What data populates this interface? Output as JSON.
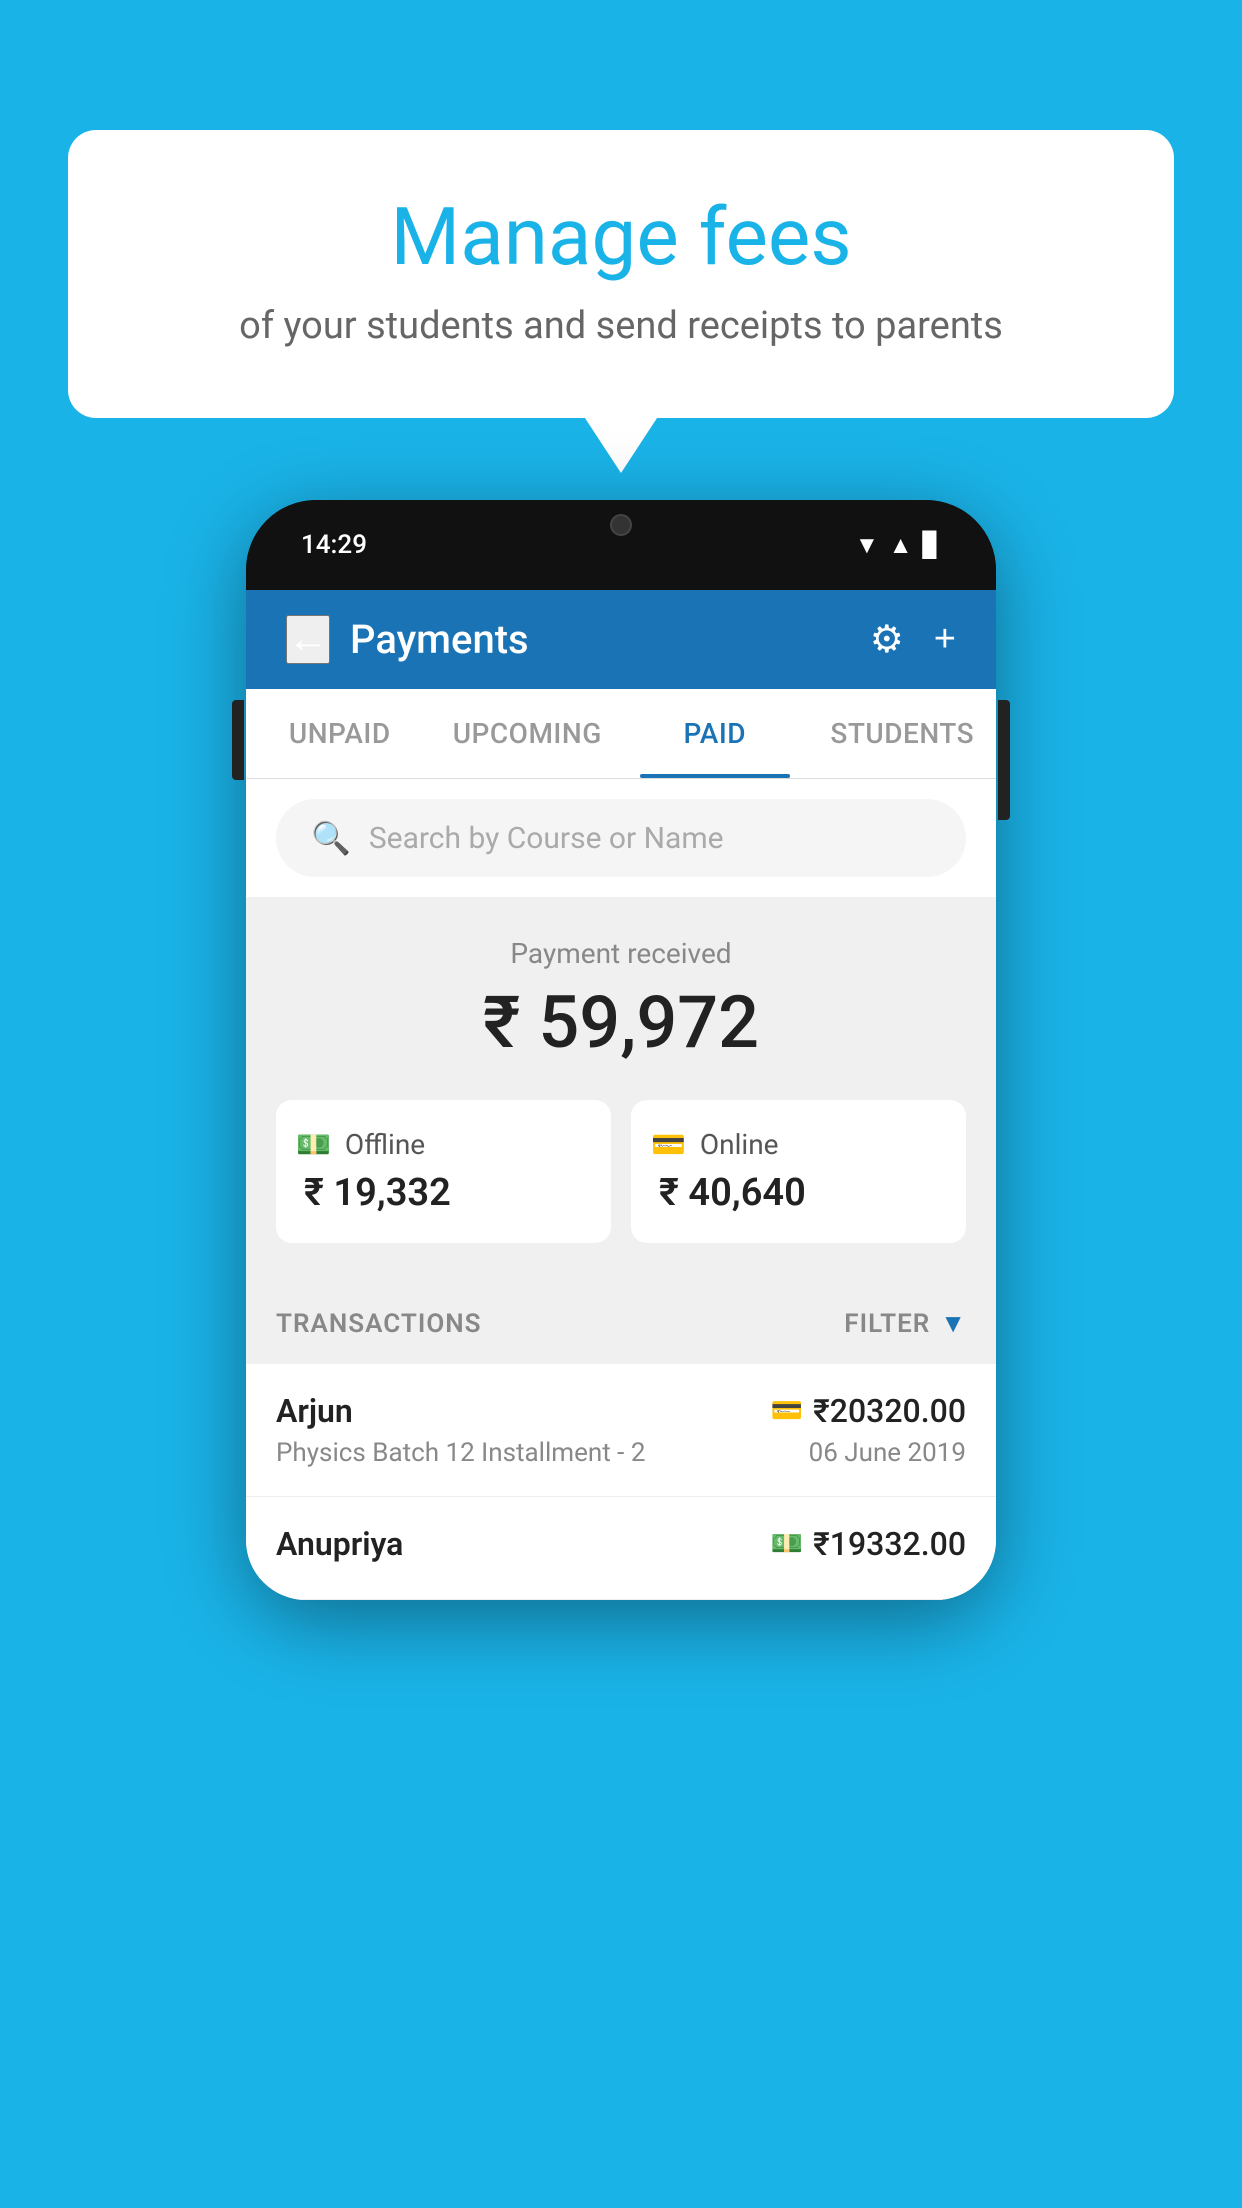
{
  "background": {
    "color": "#1ab3e8"
  },
  "speech_bubble": {
    "heading": "Manage fees",
    "subtitle": "of your students and send receipts to parents"
  },
  "phone": {
    "status_bar": {
      "time": "14:29",
      "wifi": "▲",
      "signal": "▲",
      "battery": "▊"
    },
    "header": {
      "back_label": "←",
      "title": "Payments",
      "gear_icon": "⚙",
      "plus_icon": "+"
    },
    "tabs": [
      {
        "label": "UNPAID",
        "active": false
      },
      {
        "label": "UPCOMING",
        "active": false
      },
      {
        "label": "PAID",
        "active": true
      },
      {
        "label": "STUDENTS",
        "active": false
      }
    ],
    "search": {
      "placeholder": "Search by Course or Name",
      "icon": "🔍"
    },
    "payment_summary": {
      "label": "Payment received",
      "amount": "₹ 59,972",
      "cards": [
        {
          "icon": "💳",
          "type": "Offline",
          "amount": "₹ 19,332"
        },
        {
          "icon": "💳",
          "type": "Online",
          "amount": "₹ 40,640"
        }
      ]
    },
    "transactions_section": {
      "label": "TRANSACTIONS",
      "filter_label": "FILTER",
      "rows": [
        {
          "name": "Arjun",
          "icon": "💳",
          "amount": "₹20320.00",
          "course": "Physics Batch 12 Installment - 2",
          "date": "06 June 2019"
        },
        {
          "name": "Anupriya",
          "icon": "💵",
          "amount": "₹19332.00",
          "course": "",
          "date": ""
        }
      ]
    }
  }
}
